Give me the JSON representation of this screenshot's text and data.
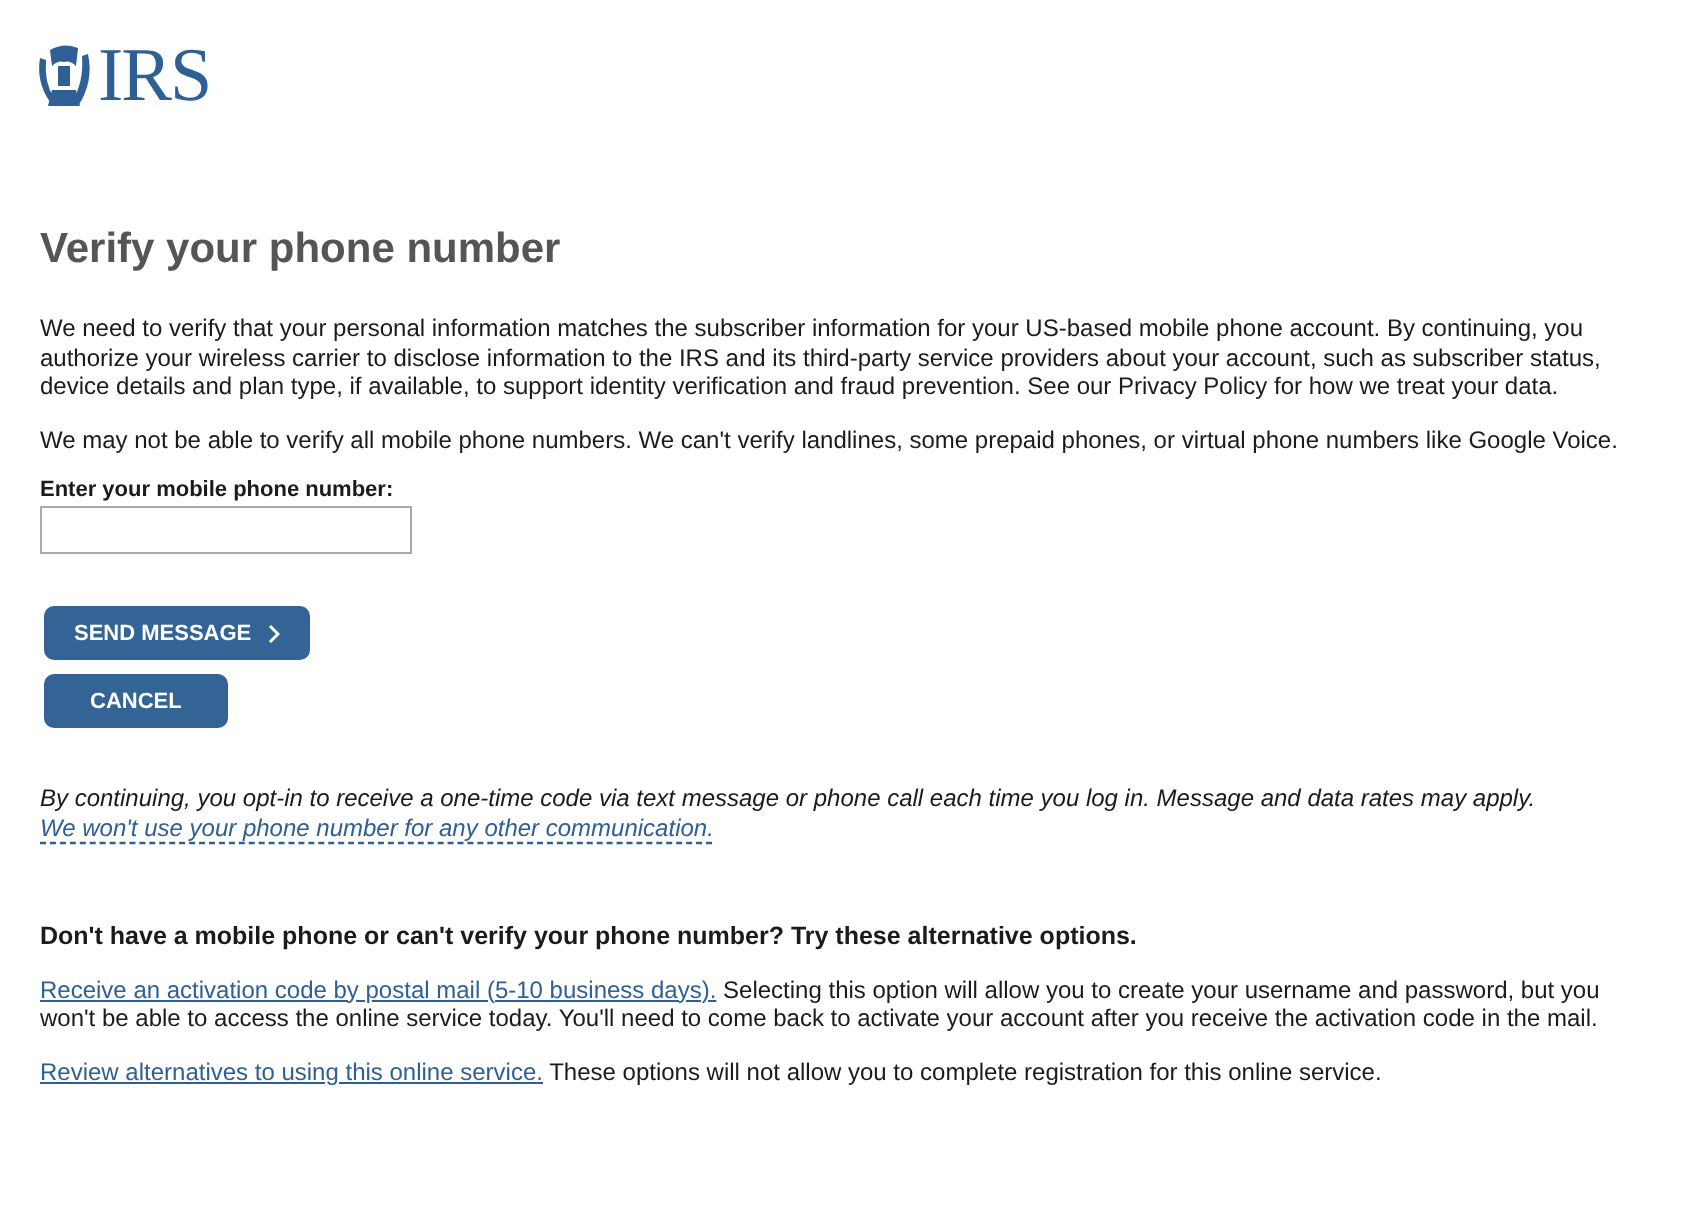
{
  "logo": {
    "text": "IRS"
  },
  "heading": "Verify your phone number",
  "paragraphs": [
    "We need to verify that your personal information matches the subscriber information for your US-based mobile phone account. By continuing, you authorize your wireless carrier to disclose information to the IRS and its third-party service providers about your account, such as subscriber status, device details and plan type, if available, to support identity verification and fraud prevention. See our Privacy Policy for how we treat your data.",
    "We may not be able to verify all mobile phone numbers. We can't verify landlines, some prepaid phones, or virtual phone numbers like Google Voice."
  ],
  "phone_field": {
    "label": "Enter your mobile phone number:"
  },
  "buttons": [
    {
      "label": "SEND MESSAGE",
      "kind": "next"
    },
    {
      "label": "CANCEL",
      "kind": "plain"
    }
  ],
  "consent": {
    "text": "By continuing, you opt-in to receive a one-time code via text message or phone call each time you log in. Message and data rates may apply.",
    "link": "We won't use your phone number for any other communication."
  },
  "alternatives": {
    "heading": "Don't have a mobile phone or can't verify your phone number? Try these alternative options.",
    "options": [
      {
        "link": "Receive an activation code by postal mail (5-10 business days).",
        "text": "Selecting this option will allow you to create your username and password, but you won't be able to access the online service today. You'll need to come back to activate your account after you receive the activation code in the mail."
      },
      {
        "link": "Review alternatives to using this online service.",
        "text": "These options will not allow you to complete registration for this online service."
      }
    ]
  }
}
